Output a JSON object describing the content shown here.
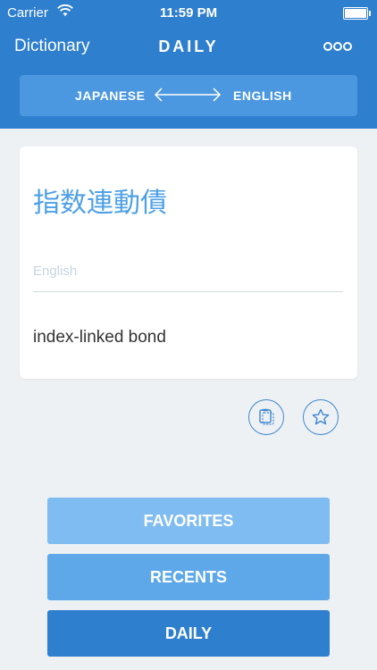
{
  "status_bar": {
    "carrier": "Carrier",
    "time": "11:59 PM"
  },
  "nav": {
    "back_label": "Dictionary",
    "title": "DAILY",
    "more_icon": "more-icon"
  },
  "language_bar": {
    "from": "JAPANESE",
    "to": "ENGLISH",
    "arrow_icon": "double-arrow-icon"
  },
  "card": {
    "term": "指数連動債",
    "field_placeholder": "English",
    "translation": "index-linked bond"
  },
  "actions": {
    "copy_icon": "copy-icon",
    "favorite_icon": "star-icon"
  },
  "bottom_buttons": [
    {
      "label": "FAVORITES",
      "color": "#7fbcf1"
    },
    {
      "label": "RECENTS",
      "color": "#5ea8ea"
    },
    {
      "label": "DAILY",
      "color": "#2f7fcf"
    }
  ],
  "colors": {
    "header": "#2f7fcf",
    "language_bar": "#4c98e0",
    "term": "#4da0e6",
    "background": "#eef1f4"
  }
}
